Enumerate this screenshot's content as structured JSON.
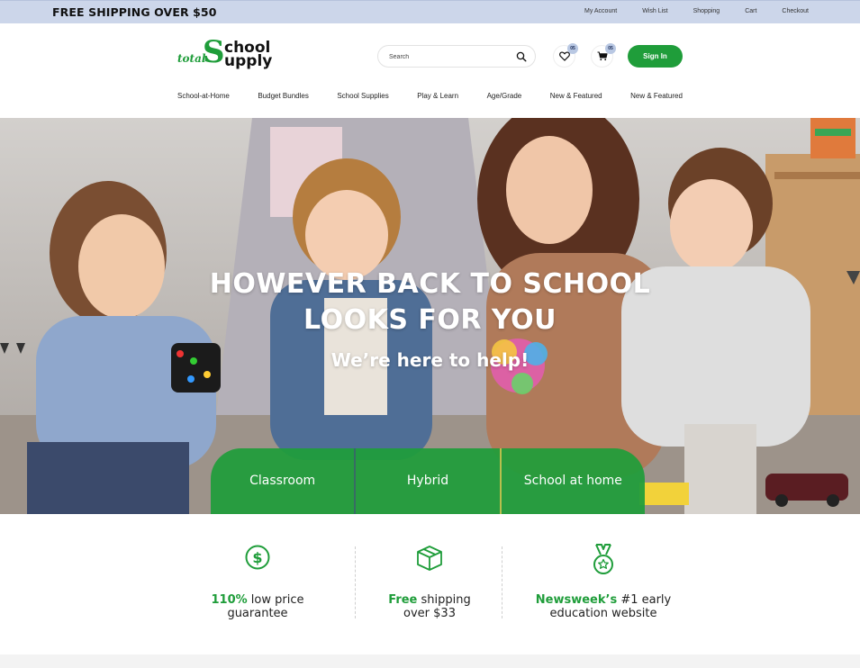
{
  "topbar": {
    "promo": "FREE SHIPPING OVER $50",
    "links": [
      "My Account",
      "Wish List",
      "Shopping",
      "Cart",
      "Checkout"
    ]
  },
  "header": {
    "logo": {
      "total": "total",
      "s": "S",
      "chool": "chool",
      "upply": "upply"
    },
    "search_placeholder": "Search",
    "wishlist_count": "05",
    "cart_count": "05",
    "signin_label": "Sign In"
  },
  "nav": [
    "School-at-Home",
    "Budget Bundles",
    "School Supplies",
    "Play & Learn",
    "Age/Grade",
    "New & Featured",
    "New & Featured"
  ],
  "hero": {
    "title_line1": "HOWEVER BACK TO SCHOOL",
    "title_line2": "LOOKS FOR YOU",
    "subtitle": "We’re here to help!",
    "tabs": [
      "Classroom",
      "Hybrid",
      "School at home"
    ]
  },
  "features": [
    {
      "icon": "dollar-circle-icon",
      "highlight": "110%",
      "rest": " low price",
      "line2": "guarantee"
    },
    {
      "icon": "box-icon",
      "highlight": "Free",
      "rest": " shipping",
      "line2": "over $33"
    },
    {
      "icon": "medal-icon",
      "highlight": "Newsweek’s",
      "rest": " #1 early",
      "line2": "education website"
    }
  ],
  "colors": {
    "brand_green": "#1f9d3a",
    "topbar_bg": "#ccd6ea"
  }
}
